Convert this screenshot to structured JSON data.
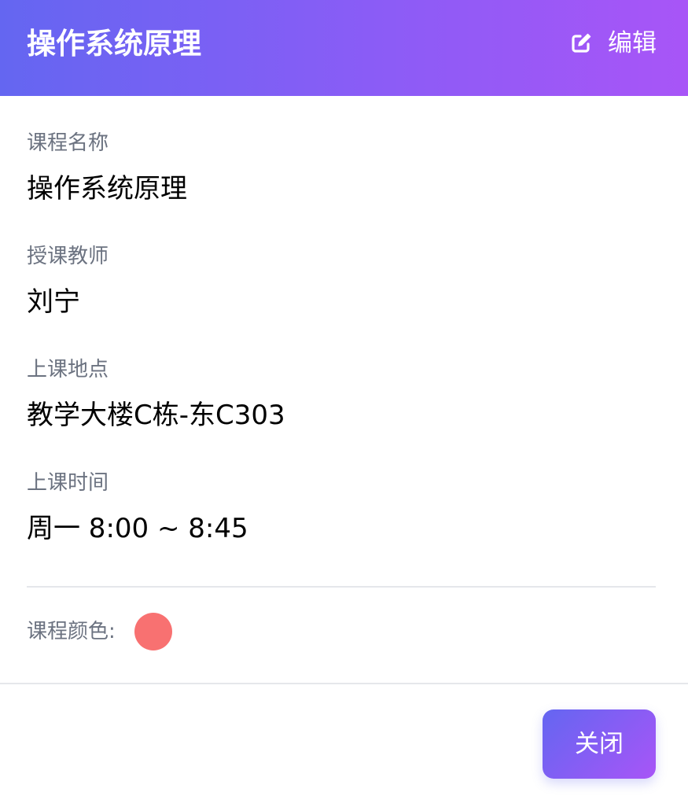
{
  "header": {
    "title": "操作系统原理",
    "edit_label": "编辑",
    "edit_icon": "edit-icon",
    "gradient_start": "#6466f1",
    "gradient_end": "#a855f7"
  },
  "fields": [
    {
      "label": "课程名称",
      "value": "操作系统原理"
    },
    {
      "label": "授课教师",
      "value": "刘宁"
    },
    {
      "label": "上课地点",
      "value": "教学大楼C栋-东C303"
    },
    {
      "label": "上课时间",
      "value": "周一 8:00 ~ 8:45"
    }
  ],
  "course_color": {
    "label": "课程颜色:",
    "value": "#f87171"
  },
  "footer": {
    "close_label": "关闭"
  },
  "colors": {
    "label_gray": "#6b7280",
    "divider": "#e5e7eb",
    "text": "#000000"
  }
}
